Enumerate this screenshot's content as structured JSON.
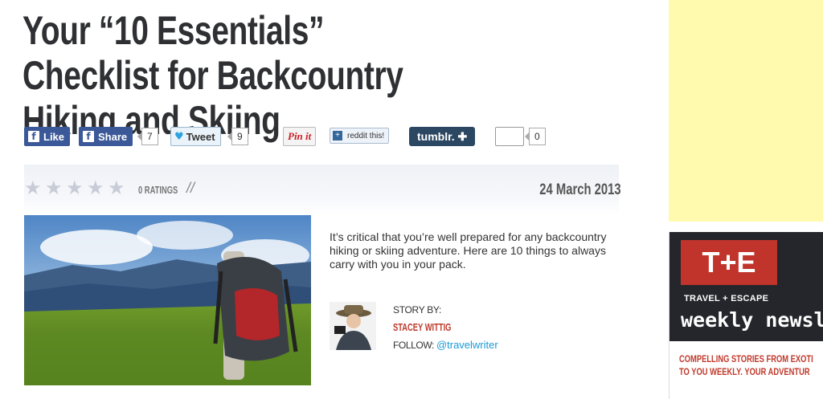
{
  "article": {
    "title": "Your “10 Essentials” Checklist for Backcountry Hiking and Skiing",
    "date": "24 March 2013",
    "ratings_label": "0 RATINGS",
    "divider": "//",
    "intro": "It’s critical that you’re well prepared for any backcountry hiking or skiing adventure. Here are 10 things to always carry with you in your pack.",
    "story_by_label": "STORY BY:",
    "author": "STACEY WITTIG",
    "follow_label": "FOLLOW: ",
    "twitter_handle": "@travelwriter"
  },
  "share": {
    "like_label": "Like",
    "share_label": "Share",
    "share_count": "7",
    "tweet_label": "Tweet",
    "tweet_count": "9",
    "pinit_label": "Pin it",
    "reddit_label": "reddit this!",
    "tumblr_label": "tumblr. ✚",
    "extra_count": "0"
  },
  "rating": {
    "stars": 5,
    "value": 0
  },
  "sidebar": {
    "promo_logo": "T+E",
    "promo_subtitle": "TRAVEL + ESCAPE",
    "promo_heading": "weekly newsl",
    "promo_line1": "COMPELLING STORIES FROM EXOTI",
    "promo_line2": "TO YOU WEEKLY. YOUR ADVENTUR"
  },
  "colors": {
    "facebook": "#3b5998",
    "twitter": "#2aa3e0",
    "pinterest": "#cb2027",
    "tumblr": "#2c4762",
    "author_accent": "#c0392b",
    "link": "#1a9ad6",
    "ad_background": "#fffaae",
    "star_empty": "#c8ccd6"
  }
}
